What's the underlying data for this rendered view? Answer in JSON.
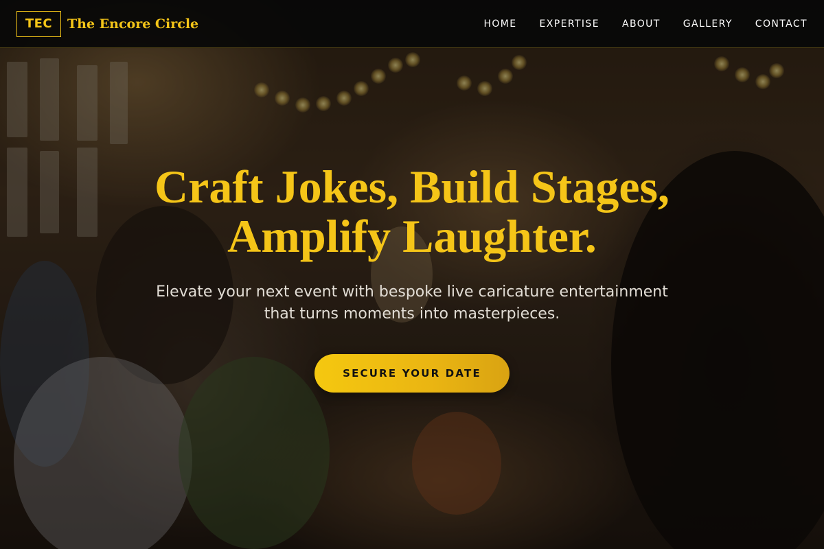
{
  "brand": {
    "logo_text": "TEC",
    "name": "The Encore Circle"
  },
  "nav": {
    "items": [
      {
        "label": "HOME"
      },
      {
        "label": "EXPERTISE"
      },
      {
        "label": "ABOUT"
      },
      {
        "label": "GALLERY"
      },
      {
        "label": "CONTACT"
      }
    ]
  },
  "hero": {
    "headline_line1": "Craft Jokes, Build Stages,",
    "headline_line2": "Amplify Laughter.",
    "subtext_line1": "Elevate your next event with bespoke live caricature entertainment",
    "subtext_line2": "that turns moments into masterpieces.",
    "cta_label": "SECURE YOUR DATE",
    "background_image_icon": "celebration-toast-photo"
  },
  "colors": {
    "accent": "#f5c518",
    "navbar_bg": "#080808",
    "text_light": "#e2ddd5"
  }
}
